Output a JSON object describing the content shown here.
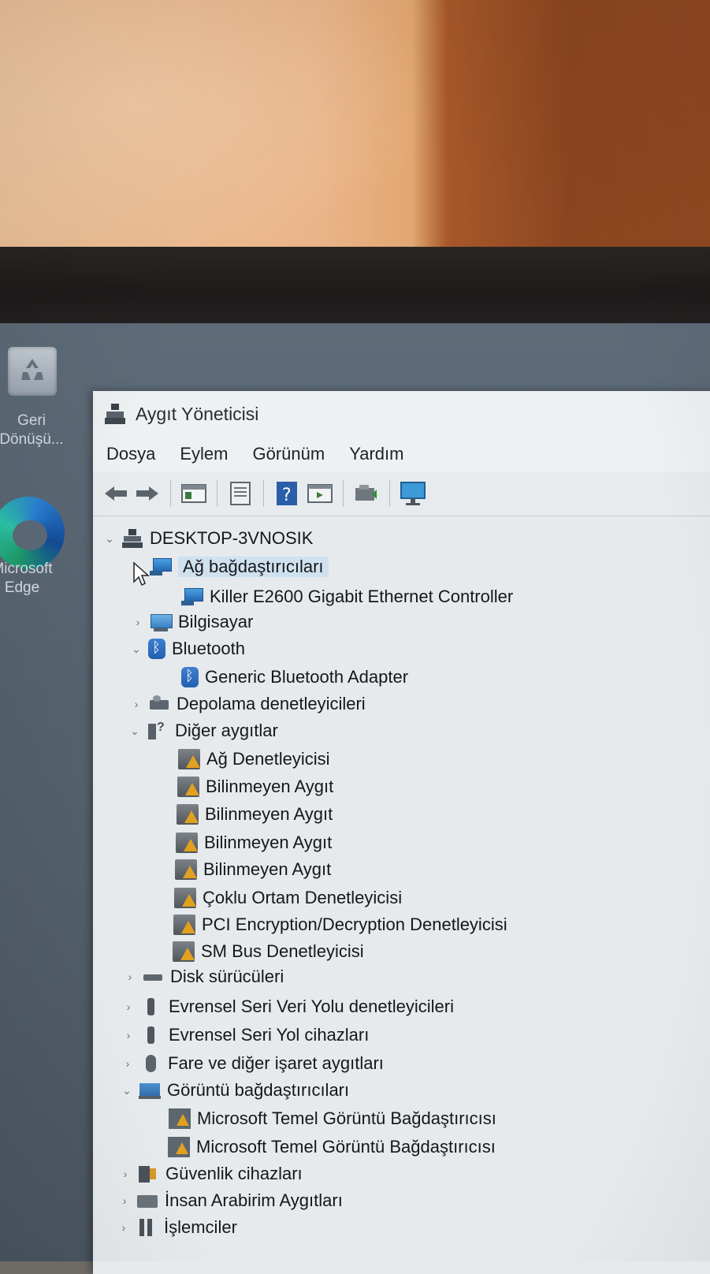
{
  "desktop": {
    "icons": [
      {
        "label_line1": "Geri",
        "label_line2": "Dönüşü..."
      },
      {
        "label_line1": "Microsoft",
        "label_line2": "Edge"
      }
    ]
  },
  "window": {
    "title": "Aygıt Yöneticisi",
    "menu": [
      "Dosya",
      "Eylem",
      "Görünüm",
      "Yardım"
    ],
    "toolbar_icons": [
      "back-icon",
      "forward-icon",
      "properties-icon",
      "properties-sheet-icon",
      "help-icon",
      "console-icon",
      "scan-hardware-icon",
      "monitor-icon"
    ]
  },
  "tree": {
    "root": "DESKTOP-3VNOSIK",
    "items": [
      {
        "label": "Ağ bağdaştırıcıları"
      },
      {
        "label": "Killer E2600 Gigabit Ethernet Controller"
      },
      {
        "label": "Bilgisayar"
      },
      {
        "label": "Bluetooth"
      },
      {
        "label": "Generic Bluetooth Adapter"
      },
      {
        "label": "Depolama denetleyicileri"
      },
      {
        "label": "Diğer aygıtlar"
      },
      {
        "label": "Ağ Denetleyicisi"
      },
      {
        "label": "Bilinmeyen Aygıt"
      },
      {
        "label": "Bilinmeyen Aygıt"
      },
      {
        "label": "Bilinmeyen Aygıt"
      },
      {
        "label": "Bilinmeyen Aygıt"
      },
      {
        "label": "Çoklu Ortam Denetleyicisi"
      },
      {
        "label": "PCI Encryption/Decryption Denetleyicisi"
      },
      {
        "label": "SM Bus Denetleyicisi"
      },
      {
        "label": "Disk sürücüleri"
      },
      {
        "label": "Evrensel Seri Veri Yolu denetleyicileri"
      },
      {
        "label": "Evrensel Seri Yol cihazları"
      },
      {
        "label": "Fare ve diğer işaret aygıtları"
      },
      {
        "label": "Görüntü bağdaştırıcıları"
      },
      {
        "label": "Microsoft Temel Görüntü Bağdaştırıcısı"
      },
      {
        "label": "Microsoft Temel Görüntü Bağdaştırıcısı"
      },
      {
        "label": "Güvenlik cihazları"
      },
      {
        "label": "İnsan Arabirim Aygıtları"
      },
      {
        "label": "İşlemciler"
      }
    ]
  },
  "colors": {
    "selection": "#cfe1ee",
    "warning": "#e8a322",
    "window_bg": "#e9edef"
  }
}
